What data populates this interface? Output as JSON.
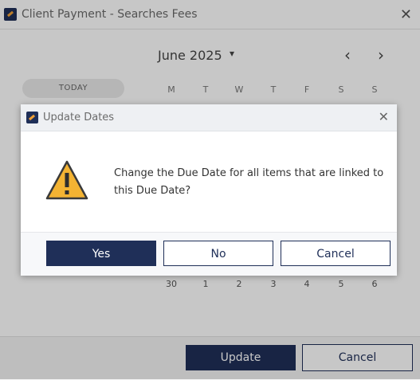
{
  "window": {
    "title": "Client Payment - Searches Fees",
    "close_glyph": "✕"
  },
  "calendar": {
    "month_label": "June 2025",
    "caret": "▾",
    "prev": "‹",
    "next": "›",
    "today_label": "TODAY",
    "weekdays": [
      "M",
      "T",
      "W",
      "T",
      "F",
      "S",
      "S"
    ],
    "bottom_row": [
      "30",
      "1",
      "2",
      "3",
      "4",
      "5",
      "6"
    ]
  },
  "footer": {
    "update_label": "Update",
    "cancel_label": "Cancel"
  },
  "dialog": {
    "title": "Update Dates",
    "close_glyph": "✕",
    "message": "Change the Due Date for all items that are linked to this Due Date?",
    "yes_label": "Yes",
    "no_label": "No",
    "cancel_label": "Cancel",
    "icon": "warning-icon",
    "warning_color": "#f3b333",
    "accent_color": "#1f2f58"
  }
}
